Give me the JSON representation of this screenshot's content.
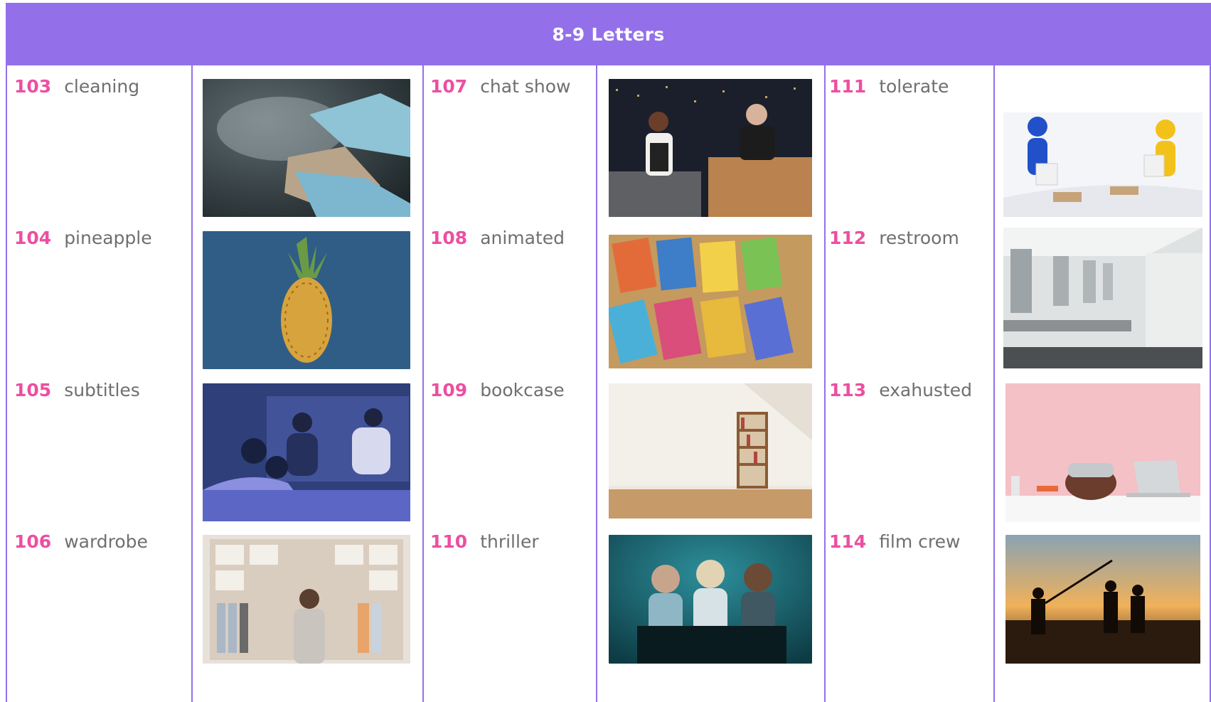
{
  "header": {
    "title": "8-9 Letters"
  },
  "entries": [
    {
      "number": "103",
      "word": "cleaning"
    },
    {
      "number": "104",
      "word": "pineapple"
    },
    {
      "number": "105",
      "word": "subtitles"
    },
    {
      "number": "106",
      "word": "wardrobe"
    },
    {
      "number": "107",
      "word": "chat show"
    },
    {
      "number": "108",
      "word": "animated"
    },
    {
      "number": "109",
      "word": "bookcase"
    },
    {
      "number": "110",
      "word": "thriller"
    },
    {
      "number": "111",
      "word": "tolerate"
    },
    {
      "number": "112",
      "word": "restroom"
    },
    {
      "number": "113",
      "word": "exahusted"
    },
    {
      "number": "114",
      "word": "film crew"
    }
  ],
  "colors": {
    "header_bg": "#9370ea",
    "number": "#ec4fa1",
    "word": "#6f6f6f"
  }
}
